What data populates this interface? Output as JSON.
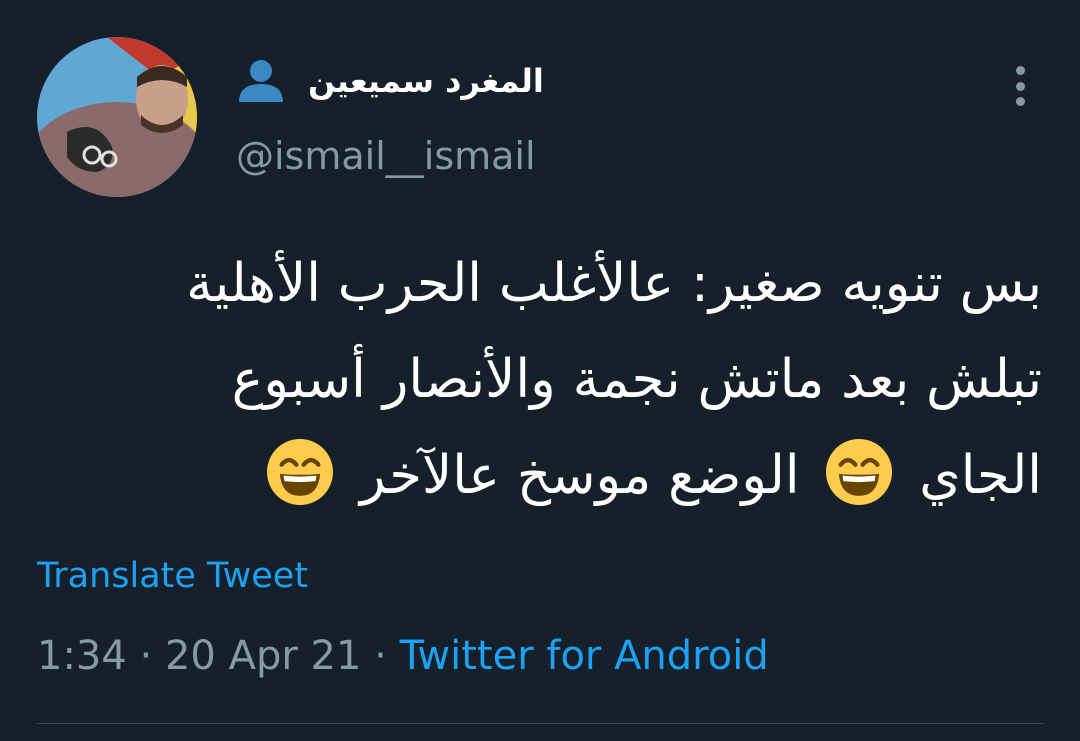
{
  "tweet": {
    "display_name": "المغرد سميعين",
    "handle": "@ismail__ismail",
    "text_lines": [
      "بس تنويه صغير: عالأغلب الحرب الأهلية",
      "تبلش بعد ماتش نجمة والأنصار أسبوع",
      {
        "before": "الجاي ",
        "middle": " الوضع موسخ عالآخر ",
        "emoji": "grinning-face-with-smiling-eyes"
      }
    ],
    "translate_label": "Translate Tweet",
    "time": "1:34",
    "date": "20 Apr 21",
    "separator": " · ",
    "source": "Twitter for Android"
  },
  "icons": {
    "name_icon": "bust-in-silhouette-icon",
    "menu_icon": "more-vertical-icon"
  },
  "colors": {
    "background": "#15202b",
    "primary_text": "#ffffff",
    "secondary_text": "#8899a6",
    "link": "#1da1f2",
    "divider": "#38444d",
    "name_icon": "#3b88c3",
    "emoji_face": "#ffcc4d"
  }
}
